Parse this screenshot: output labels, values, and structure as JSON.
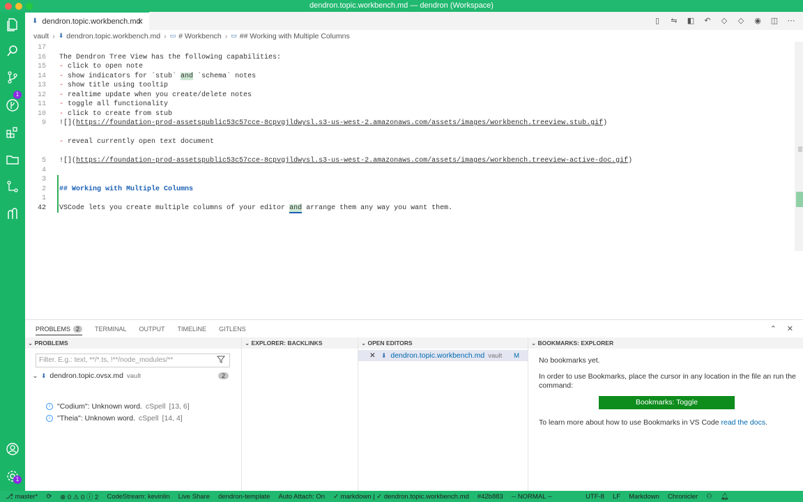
{
  "window": {
    "title": "dendron.topic.workbench.md — dendron (Workspace)"
  },
  "activity_bar": {
    "items": [
      "explorer-icon",
      "search-icon",
      "source-control-icon",
      "run-debug-icon",
      "extensions-icon",
      "folder-icon",
      "git-graph-icon",
      "dendron-icon"
    ],
    "source_control_badge": "1",
    "settings_badge": "1"
  },
  "tabs": [
    {
      "label": "dendron.topic.workbench.md",
      "active": true
    }
  ],
  "breadcrumb": {
    "parts": [
      "vault",
      "dendron.topic.workbench.md",
      "# Workbench",
      "## Working with Multiple Columns"
    ]
  },
  "editor": {
    "lines": [
      {
        "num": "17",
        "text": ""
      },
      {
        "num": "16",
        "text": "The Dendron Tree View has the following capabilities:"
      },
      {
        "num": "15",
        "dash": "-",
        "text": " click to open note"
      },
      {
        "num": "14",
        "dash": "-",
        "pre": " show indicators for `stub` ",
        "hl": "and",
        "post": " `schema` notes"
      },
      {
        "num": "13",
        "dash": "-",
        "text": " show title using tooltip"
      },
      {
        "num": "12",
        "dash": "-",
        "text": " realtime update when you create/delete notes"
      },
      {
        "num": "11",
        "dash": "-",
        "text": " toggle all functionality"
      },
      {
        "num": "10",
        "dash": "-",
        "text": " click to create from stub"
      },
      {
        "num": "9",
        "prefix": "![](",
        "link": "https://foundation-prod-assetspublic53c57cce-8cpvgjldwysl.s3-us-west-2.amazonaws.com/assets/images/workbench.treeview.stub.gif",
        "suffix": ")"
      },
      {
        "num": "",
        "text": ""
      },
      {
        "num": "",
        "dash": "-",
        "text": " reveal currently open text document"
      },
      {
        "num": "",
        "text": ""
      },
      {
        "num": "5",
        "prefix": "![](",
        "link": "https://foundation-prod-assetspublic53c57cce-8cpvgjldwysl.s3-us-west-2.amazonaws.com/assets/images/workbench.treeview-active-doc.gif",
        "suffix": ")"
      },
      {
        "num": "4",
        "text": ""
      },
      {
        "num": "3",
        "text": ""
      },
      {
        "num": "2",
        "heading": "## Working with Multiple Columns"
      },
      {
        "num": "1",
        "text": ""
      },
      {
        "num": "42",
        "pre": "VSCode lets you create multiple columns of your editor ",
        "hl": "and",
        "post": " arrange them any way you want them."
      }
    ]
  },
  "panel": {
    "tabs": [
      {
        "label": "PROBLEMS",
        "badge": "2",
        "active": true
      },
      {
        "label": "TERMINAL"
      },
      {
        "label": "OUTPUT"
      },
      {
        "label": "TIMELINE"
      },
      {
        "label": "GITLENS"
      }
    ],
    "problems": {
      "header": "PROBLEMS",
      "filter_placeholder": "Filter. E.g.: text, **/*.ts, !**/node_modules/**",
      "file": {
        "name": "dendron.topic.ovsx.md",
        "vault": "vault",
        "count": "2"
      },
      "items": [
        {
          "message": "\"Codium\": Unknown word.",
          "source": "cSpell",
          "pos": "[13, 6]"
        },
        {
          "message": "\"Theia\": Unknown word.",
          "source": "cSpell",
          "pos": "[14, 4]"
        }
      ]
    },
    "backlinks": {
      "header": "EXPLORER: BACKLINKS"
    },
    "open_editors": {
      "header": "OPEN EDITORS",
      "item": {
        "name": "dendron.topic.workbench.md",
        "vault": "vault",
        "status": "M"
      }
    },
    "bookmarks": {
      "header": "BOOKMARKS: EXPLORER",
      "empty": "No bookmarks yet.",
      "instructions": "In order to use Bookmarks, place the cursor in any location in the file an run the command:",
      "button": "Bookmarks: Toggle",
      "learn_prefix": "To learn more about how to use Bookmarks in VS Code ",
      "learn_link": "read the docs",
      "learn_suffix": "."
    }
  },
  "status_bar": {
    "items": [
      "master*",
      "⊗ 0 ⚠ 0 ⓘ 2",
      "CodeStream: kevinlin",
      "Live Share",
      "dendron-template",
      "Auto Attach: On",
      "✓ markdown | ✓ dendron.topic.workbench.md",
      "#42b883",
      "-- NORMAL --",
      "UTF-8",
      "LF",
      "Markdown",
      "Chronicler"
    ]
  },
  "colors": {
    "accent": "#21b86f",
    "statusbar": "#21b86f",
    "button": "#0e8c1c",
    "link": "#006ab1"
  }
}
